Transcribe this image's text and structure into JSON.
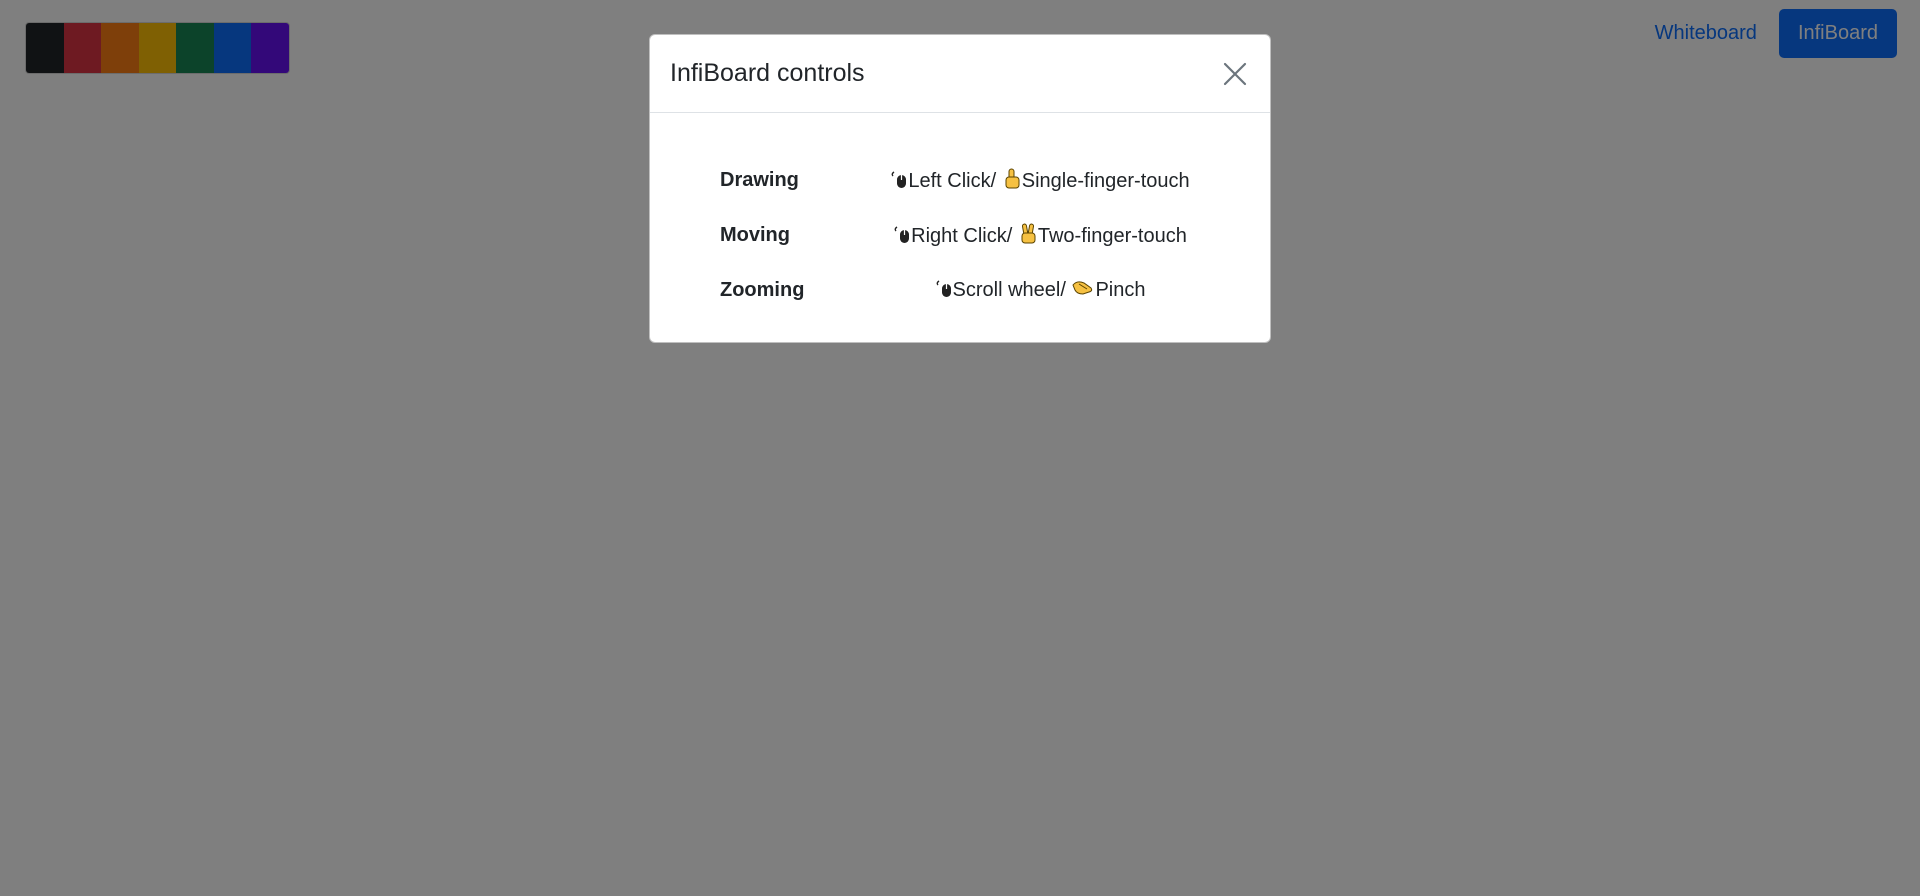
{
  "palette": {
    "colors": [
      "#212529",
      "#dc3545",
      "#fd7e14",
      "#ffc107",
      "#198754",
      "#0d6efd",
      "#6610f2"
    ]
  },
  "nav": {
    "whiteboard_label": "Whiteboard",
    "infiboard_label": "InfiBoard"
  },
  "modal": {
    "title": "InfiBoard controls",
    "controls": [
      {
        "name": "Drawing",
        "mouse": "Left Click/",
        "touch": "Single-finger-touch",
        "mouse_icon": "mouse-icon",
        "touch_icon": "pointing-finger-icon"
      },
      {
        "name": "Moving",
        "mouse": "Right Click/",
        "touch": "Two-finger-touch",
        "mouse_icon": "mouse-icon",
        "touch_icon": "victory-hand-icon"
      },
      {
        "name": "Zooming",
        "mouse": "Scroll wheel/",
        "touch": "Pinch",
        "mouse_icon": "mouse-icon",
        "touch_icon": "pinching-hand-icon"
      }
    ]
  }
}
